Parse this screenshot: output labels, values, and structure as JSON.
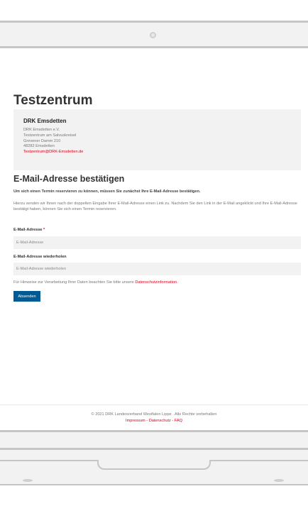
{
  "page": {
    "title": "Testzentrum"
  },
  "info": {
    "name": "DRK Emsdetten",
    "lines": [
      "DRK Emsdetten e.V.",
      "Testzentrum am Salvuskreisel",
      "Grevener Damm 210",
      "48282 Emsdetten"
    ],
    "email": "Testzentrum@DRK-Emsdetten.de"
  },
  "form": {
    "heading": "E-Mail-Adresse bestätigen",
    "lead": "Um sich einen Termin reservieren zu können, müssen Sie zunächst Ihre E-Mail-Adresse bestätigen.",
    "paragraph": "Hierzu senden wir Ihnen nach der doppelten Eingabe Ihrer E-Mail-Adresse einen Link zu. Nachdem Sie den Link in der E-Mail angeklickt und Ihre E-Mail-Adresse bestätigt haben, können Sie sich einen Termin reservieren.",
    "email_label": "E-Mail-Adresse",
    "required_mark": "*",
    "email_placeholder": "E-Mail-Adresse",
    "email_value": "",
    "repeat_label": "E-Mail-Adresse wiederholen",
    "repeat_placeholder": "E-Mail-Adresse wiederholen",
    "repeat_value": "",
    "hint_text": "Für Hinweise zur Verarbeitung Ihrer Daten beachten Sie bitte unsere ",
    "hint_link": "Datenschutzinformation",
    "hint_suffix": ".",
    "submit_label": "Absenden"
  },
  "footer": {
    "copyright": "© 2021 DRK Landesverband Westfalen Lippe . Alle Rechte vorbehalten",
    "links": [
      {
        "label": "Impressum"
      },
      {
        "label": "Datenschutz"
      },
      {
        "label": "FAQ"
      }
    ],
    "separator": " - "
  },
  "colors": {
    "accent": "#d7001a",
    "button": "#005a94",
    "panel": "#f2f2f2"
  }
}
